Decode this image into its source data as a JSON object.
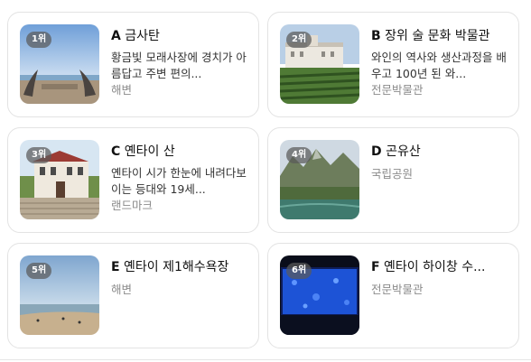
{
  "places": [
    {
      "rank": "1위",
      "letter": "A",
      "name": "금사탄",
      "description": "황금빛 모래사장에 경치가 아름답고 주변 편의...",
      "category": "해변",
      "image": "beach-sculpture-photo"
    },
    {
      "rank": "2위",
      "letter": "B",
      "name": "장위 술 문화 박물관",
      "description": "와인의 역사와 생산과정을 배우고 100년 된 와...",
      "category": "전문박물관",
      "image": "winery-vineyard-photo"
    },
    {
      "rank": "3위",
      "letter": "C",
      "name": "옌타이 산",
      "description": "옌타이 시가 한눈에 내려다보이는 등대와 19세...",
      "category": "랜드마크",
      "image": "historic-building-photo"
    },
    {
      "rank": "4위",
      "letter": "D",
      "name": "곤유산",
      "description": "",
      "category": "국립공원",
      "image": "mountain-lake-photo"
    },
    {
      "rank": "5위",
      "letter": "E",
      "name": "옌타이 제1해수욕장",
      "description": "",
      "category": "해변",
      "image": "bathing-beach-photo"
    },
    {
      "rank": "6위",
      "letter": "F",
      "name": "옌타이 하이창 수...",
      "description": "",
      "category": "전문박물관",
      "image": "aquarium-tank-photo"
    }
  ],
  "colors": {
    "border": "#e3e3e3",
    "category_text": "#8b8b8b",
    "rank_badge": "#5a5a5a"
  }
}
